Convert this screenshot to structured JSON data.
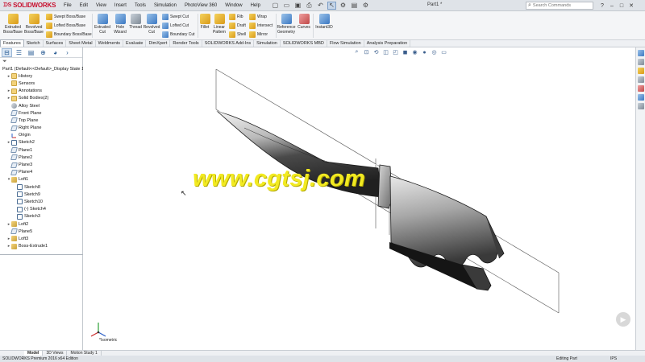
{
  "app": {
    "brand": "SOLIDWORKS",
    "document_title": "Part1 *",
    "menu": [
      "File",
      "Edit",
      "View",
      "Insert",
      "Tools",
      "Simulation",
      "PhotoView 360",
      "Window",
      "Help"
    ],
    "search_placeholder": "Search Commands"
  },
  "ribbon": {
    "large_buttons": [
      {
        "id": "extruded-boss",
        "label": "Extruded\nBoss/Base"
      },
      {
        "id": "revolved-boss",
        "label": "Revolved\nBoss/Base"
      },
      {
        "id": "extruded-cut",
        "label": "Extruded\nCut"
      },
      {
        "id": "hole-wizard",
        "label": "Hole\nWizard"
      },
      {
        "id": "thread",
        "label": "Thread"
      },
      {
        "id": "revolved-cut",
        "label": "Revolved\nCut"
      },
      {
        "id": "fillet",
        "label": "Fillet"
      },
      {
        "id": "linear-pattern",
        "label": "Linear\nPattern"
      },
      {
        "id": "reference-geometry",
        "label": "Reference\nGeometry"
      },
      {
        "id": "curves",
        "label": "Curves"
      },
      {
        "id": "instant3d",
        "label": "Instant3D"
      }
    ],
    "small_buttons": [
      {
        "id": "swept-boss",
        "label": "Swept Boss/Base"
      },
      {
        "id": "lofted-boss",
        "label": "Lofted Boss/Base"
      },
      {
        "id": "boundary-boss",
        "label": "Boundary Boss/Base"
      },
      {
        "id": "swept-cut",
        "label": "Swept Cut"
      },
      {
        "id": "lofted-cut",
        "label": "Lofted Cut"
      },
      {
        "id": "boundary-cut",
        "label": "Boundary Cut"
      },
      {
        "id": "rib",
        "label": "Rib"
      },
      {
        "id": "draft",
        "label": "Draft"
      },
      {
        "id": "shell",
        "label": "Shell"
      },
      {
        "id": "wrap",
        "label": "Wrap"
      },
      {
        "id": "intersect",
        "label": "Intersect"
      },
      {
        "id": "mirror",
        "label": "Mirror"
      }
    ]
  },
  "tabs": [
    "Features",
    "Sketch",
    "Surfaces",
    "Sheet Metal",
    "Weldments",
    "Evaluate",
    "DimXpert",
    "Render Tools",
    "SOLIDWORKS Add-Ins",
    "Simulation",
    "SOLIDWORKS MBD",
    "Flow Simulation",
    "Analysis Preparation"
  ],
  "active_tab": "Features",
  "feature_tree": [
    {
      "label": "Part1  (Default<<Default>_Display State 1",
      "icon": "part",
      "indent": 0,
      "expander": ""
    },
    {
      "label": "History",
      "icon": "folder",
      "indent": 1,
      "expander": "▸"
    },
    {
      "label": "Sensors",
      "icon": "folder",
      "indent": 1,
      "expander": ""
    },
    {
      "label": "Annotations",
      "icon": "folder",
      "indent": 1,
      "expander": "▸"
    },
    {
      "label": "Solid Bodies(2)",
      "icon": "folder",
      "indent": 1,
      "expander": "▸"
    },
    {
      "label": "Alloy Steel",
      "icon": "material",
      "indent": 1,
      "expander": ""
    },
    {
      "label": "Front Plane",
      "icon": "plane",
      "indent": 1,
      "expander": ""
    },
    {
      "label": "Top Plane",
      "icon": "plane",
      "indent": 1,
      "expander": ""
    },
    {
      "label": "Right Plane",
      "icon": "plane",
      "indent": 1,
      "expander": ""
    },
    {
      "label": "Origin",
      "icon": "origin",
      "indent": 1,
      "expander": ""
    },
    {
      "label": "Sketch2",
      "icon": "sketch",
      "indent": 1,
      "expander": "▸"
    },
    {
      "label": "Plane1",
      "icon": "plane",
      "indent": 1,
      "expander": ""
    },
    {
      "label": "Plane2",
      "icon": "plane",
      "indent": 1,
      "expander": ""
    },
    {
      "label": "Plane3",
      "icon": "plane",
      "indent": 1,
      "expander": ""
    },
    {
      "label": "Plane4",
      "icon": "plane",
      "indent": 1,
      "expander": ""
    },
    {
      "label": "Loft1",
      "icon": "feature",
      "indent": 1,
      "expander": "▾"
    },
    {
      "label": "Sketch8",
      "icon": "sketch",
      "indent": 2,
      "expander": ""
    },
    {
      "label": "Sketch9",
      "icon": "sketch",
      "indent": 2,
      "expander": ""
    },
    {
      "label": "Sketch10",
      "icon": "sketch",
      "indent": 2,
      "expander": ""
    },
    {
      "label": "(-) Sketch4",
      "icon": "sketch",
      "indent": 2,
      "expander": ""
    },
    {
      "label": "Sketch3",
      "icon": "sketch",
      "indent": 2,
      "expander": ""
    },
    {
      "label": "Loft2",
      "icon": "feature",
      "indent": 1,
      "expander": "▸"
    },
    {
      "label": "Plane5",
      "icon": "plane",
      "indent": 1,
      "expander": ""
    },
    {
      "label": "Loft3",
      "icon": "feature",
      "indent": 1,
      "expander": "▸"
    },
    {
      "label": "Boss-Extrude1",
      "icon": "feature",
      "indent": 1,
      "expander": "▸"
    }
  ],
  "viewport": {
    "watermark": "www.cgtsj.com",
    "view_name": "*Isometric"
  },
  "bottom_tabs": [
    "Model",
    "3D Views",
    "Motion Study 1"
  ],
  "active_bottom_tab": "Model",
  "status": {
    "left": "SOLIDWORKS Premium 2016 x64 Edition",
    "mode": "Editing Part",
    "units": "IPS"
  },
  "colors": {
    "brand_red": "#c8102e",
    "watermark_yellow": "#f2ea21",
    "selection_blue": "#c5d5e8"
  }
}
